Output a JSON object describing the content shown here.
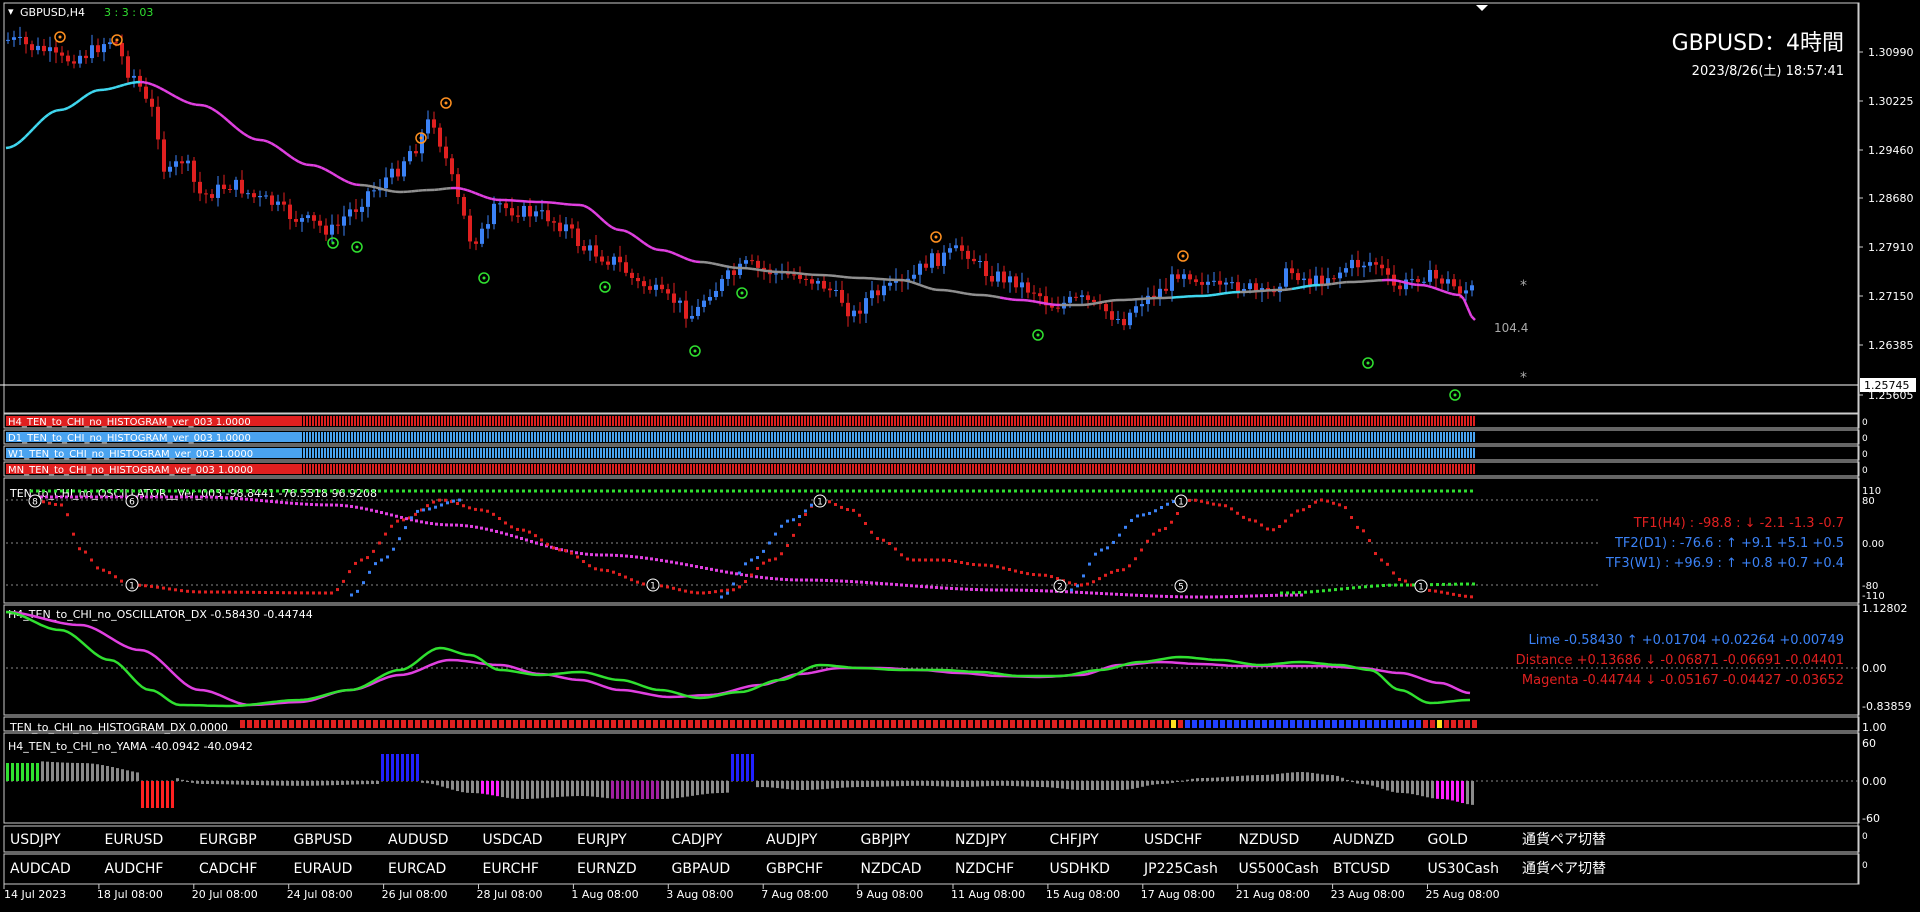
{
  "header": {
    "symbol": "GBPUSD,H4",
    "timer": "3 : 3 : 03",
    "title": "GBPUSD：4時間",
    "datetime": "2023/8/26(土) 18:57:41"
  },
  "main_chart": {
    "price_ticks": [
      "1.30990",
      "1.30225",
      "1.29460",
      "1.28680",
      "1.27910",
      "1.27150",
      "1.26385",
      "1.25605"
    ],
    "current_price": "1.25745",
    "level_label": "104.4",
    "star": "*"
  },
  "histograms": [
    {
      "label": "H4_TEN_to_CHI_no_HISTOGRAM_ver_003 1.0000",
      "color": "#e02020"
    },
    {
      "label": "D1_TEN_to_CHI_no_HISTOGRAM_ver_003 1.0000",
      "color": "#4aa3f0"
    },
    {
      "label": "W1_TEN_to_CHI_no_HISTOGRAM_ver_003 1.0000",
      "color": "#4aa3f0"
    },
    {
      "label": "MN_TEN_to_CHI_no_HISTOGRAM_ver_003 1.0000",
      "color": "#e02020"
    }
  ],
  "oscillator": {
    "label": "TEN_to_CHI_no_OSCILLATOR__Ver_003 -98.8441 -76.5518 96.9208",
    "ticks": [
      "110",
      "80",
      "0.00",
      "-80",
      "-110"
    ],
    "rows": [
      {
        "text": "TF1(H4) : -98.8 : ↓ -2.1 -1.3 -0.7",
        "color": "#e02020"
      },
      {
        "text": "TF2(D1) : -76.6 : ↑ +9.1 +5.1 +0.5",
        "color": "#3b82f6"
      },
      {
        "text": "TF3(W1) : +96.9 : ↑ +0.8 +0.7 +0.4",
        "color": "#3b82f6"
      }
    ]
  },
  "oscillator_dx": {
    "label": "H4_TEN_to_CHI_no_OSCILLATOR_DX -0.58430 -0.44744",
    "ticks": [
      "1.12802",
      "0.00",
      "-0.83859"
    ],
    "rows": [
      {
        "text": "Lime -0.58430 ↑ +0.01704 +0.02264 +0.00749",
        "color": "#3b82f6"
      },
      {
        "text": "Distance +0.13686 ↓ -0.06871 -0.06691 -0.04401",
        "color": "#e02020"
      },
      {
        "text": "Magenta -0.44744 ↓ -0.05167 -0.04427 -0.03652",
        "color": "#e02020"
      }
    ]
  },
  "histogram_dx": {
    "label": "TEN_to_CHI_no_HISTOGRAM_DX 0.0000",
    "tick": "1.00"
  },
  "yama": {
    "label": "H4_TEN_to_CHI_no_YAMA -40.0942 -40.0942",
    "ticks": [
      "60",
      "0.00",
      "-60"
    ]
  },
  "symbol_row1": [
    "USDJPY",
    "EURUSD",
    "EURGBP",
    "GBPUSD",
    "AUDUSD",
    "USDCAD",
    "EURJPY",
    "CADJPY",
    "AUDJPY",
    "GBPJPY",
    "NZDJPY",
    "CHFJPY",
    "USDCHF",
    "NZDUSD",
    "AUDNZD",
    "GOLD",
    "通貨ペア切替"
  ],
  "symbol_row2": [
    "AUDCAD",
    "AUDCHF",
    "CADCHF",
    "EURAUD",
    "EURCAD",
    "EURCHF",
    "EURNZD",
    "GBPAUD",
    "GBPCHF",
    "NZDCAD",
    "NZDCHF",
    "USDHKD",
    "JP225Cash",
    "US500Cash",
    "BTCUSD",
    "US30Cash",
    "通貨ペア切替"
  ],
  "time_axis": [
    "14 Jul 2023",
    "18 Jul 08:00",
    "20 Jul 08:00",
    "24 Jul 08:00",
    "26 Jul 08:00",
    "28 Jul 08:00",
    "1 Aug 08:00",
    "3 Aug 08:00",
    "7 Aug 08:00",
    "9 Aug 08:00",
    "11 Aug 08:00",
    "15 Aug 08:00",
    "17 Aug 08:00",
    "21 Aug 08:00",
    "23 Aug 08:00",
    "25 Aug 08:00"
  ],
  "colors": {
    "bull": "#3b82f6",
    "bear": "#e02020",
    "ma_magenta": "#e040e0",
    "ma_cyan": "#40d8f0",
    "ma_gray": "#909090",
    "lime": "#30e030"
  }
}
